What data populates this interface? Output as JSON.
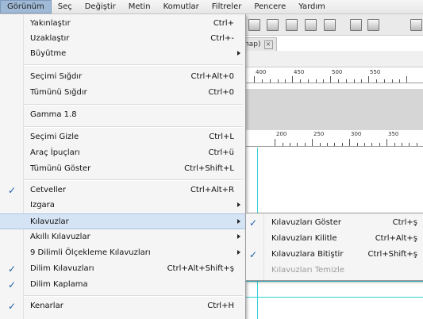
{
  "menubar": {
    "items": [
      "Görünüm",
      "Seç",
      "Değiştir",
      "Metin",
      "Komutlar",
      "Filtreler",
      "Pencere",
      "Yardım"
    ]
  },
  "document_tab": {
    "label": "map)"
  },
  "rulers": {
    "top": [
      "400",
      "450",
      "500",
      "550"
    ],
    "second": [
      "200",
      "250",
      "300",
      "350"
    ]
  },
  "view_menu": {
    "items": [
      {
        "label": "Yakınlaştır",
        "shortcut": "Ctrl+",
        "checked": false,
        "submenu": false
      },
      {
        "label": "Uzaklaştır",
        "shortcut": "Ctrl+-",
        "checked": false,
        "submenu": false
      },
      {
        "label": "Büyütme",
        "shortcut": "",
        "checked": false,
        "submenu": true
      },
      {
        "label": "Seçimi Sığdır",
        "shortcut": "Ctrl+Alt+0",
        "checked": false,
        "submenu": false
      },
      {
        "label": "Tümünü Sığdır",
        "shortcut": "Ctrl+0",
        "checked": false,
        "submenu": false
      },
      {
        "label": "Gamma 1.8",
        "shortcut": "",
        "checked": false,
        "submenu": false
      },
      {
        "label": "Seçimi Gizle",
        "shortcut": "Ctrl+L",
        "checked": false,
        "submenu": false
      },
      {
        "label": "Araç İpuçları",
        "shortcut": "Ctrl+ü",
        "checked": false,
        "submenu": false
      },
      {
        "label": "Tümünü Göster",
        "shortcut": "Ctrl+Shift+L",
        "checked": false,
        "submenu": false
      },
      {
        "label": "Cetveller",
        "shortcut": "Ctrl+Alt+R",
        "checked": true,
        "submenu": false
      },
      {
        "label": "Izgara",
        "shortcut": "",
        "checked": false,
        "submenu": true
      },
      {
        "label": "Kılavuzlar",
        "shortcut": "",
        "checked": false,
        "submenu": true,
        "highlighted": true
      },
      {
        "label": "Akıllı Kılavuzlar",
        "shortcut": "",
        "checked": false,
        "submenu": true
      },
      {
        "label": "9 Dilimli Ölçekleme Kılavuzları",
        "shortcut": "",
        "checked": false,
        "submenu": true
      },
      {
        "label": "Dilim Kılavuzları",
        "shortcut": "Ctrl+Alt+Shift+ş",
        "checked": true,
        "submenu": false
      },
      {
        "label": "Dilim Kaplama",
        "shortcut": "",
        "checked": true,
        "submenu": false
      },
      {
        "label": "Kenarlar",
        "shortcut": "Ctrl+H",
        "checked": true,
        "submenu": false
      }
    ]
  },
  "guides_submenu": {
    "items": [
      {
        "label": "Kılavuzları Göster",
        "shortcut": "Ctrl+ş",
        "checked": true,
        "disabled": false
      },
      {
        "label": "Kılavuzları Kilitle",
        "shortcut": "Ctrl+Alt+ş",
        "checked": false,
        "disabled": false
      },
      {
        "label": "Kılavuzlara Bitiştir",
        "shortcut": "Ctrl+Shift+ş",
        "checked": true,
        "disabled": false
      },
      {
        "label": "Kılavuzları Temizle",
        "shortcut": "",
        "checked": false,
        "disabled": true
      }
    ]
  },
  "icons": {
    "check": "check-icon",
    "submenu": "submenu-arrow-icon",
    "close": "close-icon"
  },
  "colors": {
    "highlight": "#d5e4f5",
    "check": "#1f5fa8",
    "guide": "#2fd0d6"
  }
}
